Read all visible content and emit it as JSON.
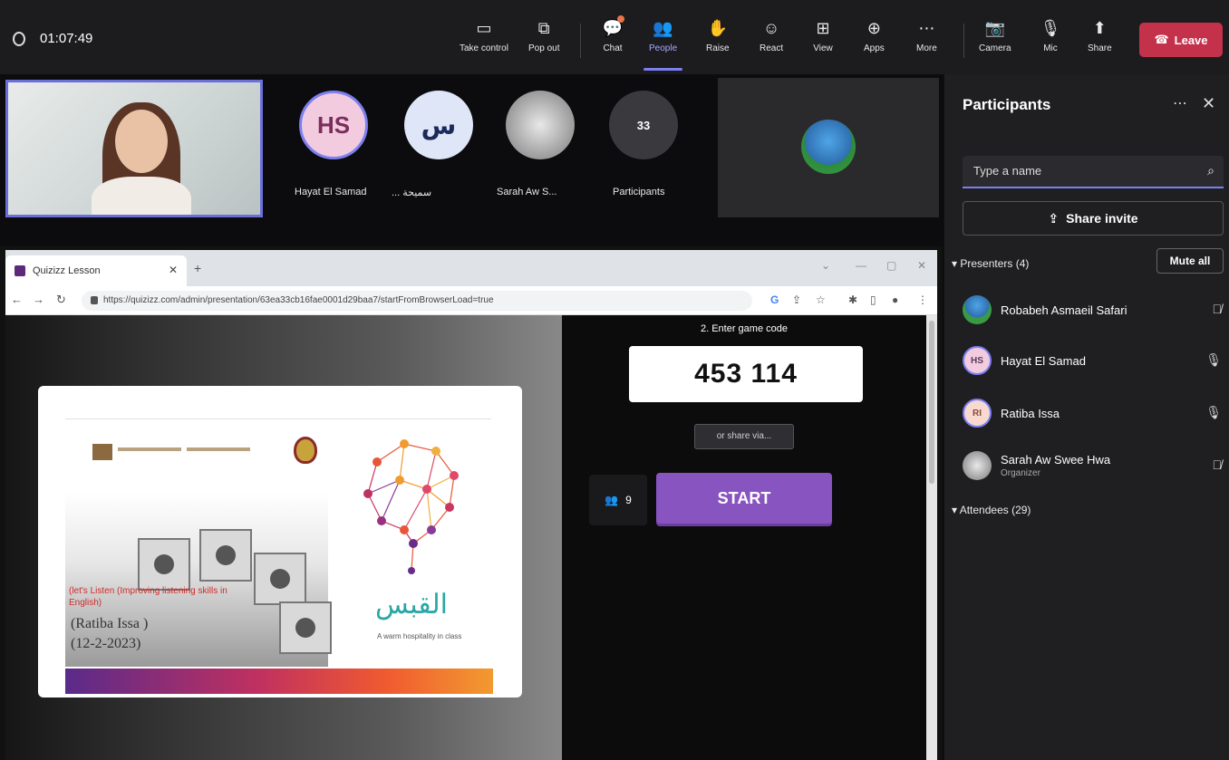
{
  "meeting": {
    "timer": "01:07:49",
    "toolbar": {
      "take_control": "Take control",
      "pop_out": "Pop out",
      "chat": "Chat",
      "people": "People",
      "raise": "Raise",
      "react": "React",
      "view": "View",
      "apps": "Apps",
      "more": "More",
      "camera": "Camera",
      "mic": "Mic",
      "share": "Share",
      "leave": "Leave"
    }
  },
  "video_row": {
    "tiles": [
      {
        "initials": "HS",
        "name": "Hayat El Samad",
        "color": "#f2cbdf"
      },
      {
        "initials": "س",
        "name": "... سميحة",
        "color": "#dfe6f7"
      },
      {
        "initials": "",
        "name": "Sarah Aw S...",
        "color": "#c9c9c9"
      },
      {
        "initials": "33",
        "name": "Participants",
        "color": "#3a3a3e"
      }
    ]
  },
  "browser": {
    "tab_title": "Quizizz Lesson",
    "url": "https://quizizz.com/admin/presentation/63ea33cb16fae0001d29baa7/startFromBrowserLoad=true",
    "slide": {
      "lesson_title": "(let's Listen (Improving listening skills in English)",
      "teacher": "(Ratiba Issa )",
      "date": "(12-2-2023)",
      "brand_arabic": "القبس",
      "tagline": "A warm hospitality in class"
    },
    "quiz": {
      "step_label": "2. Enter game code",
      "game_code": "453 114",
      "share_label": "or share via...",
      "players_count": "9",
      "start_label": "START"
    }
  },
  "participants_panel": {
    "title": "Participants",
    "search_placeholder": "Type a name",
    "share_invite": "Share invite",
    "presenters_label": "Presenters (4)",
    "mute_all": "Mute all",
    "attendees_label": "Attendees (29)",
    "presenters": [
      {
        "name": "Robabeh Asmaeil Safari",
        "initials": "",
        "role": "",
        "mic": "muted"
      },
      {
        "name": "Hayat El Samad",
        "initials": "HS",
        "role": "",
        "mic": "on"
      },
      {
        "name": "Ratiba Issa",
        "initials": "RI",
        "role": "",
        "mic": "on"
      },
      {
        "name": "Sarah Aw Swee Hwa",
        "initials": "",
        "role": "Organizer",
        "mic": "muted"
      }
    ]
  }
}
